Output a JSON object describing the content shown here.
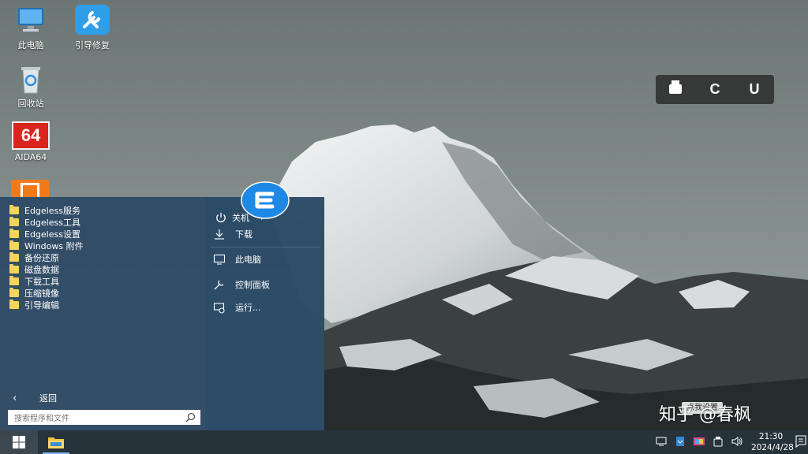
{
  "desktop": {
    "icons": [
      {
        "label": "此电脑"
      },
      {
        "label": "引导修复"
      },
      {
        "label": "回收站"
      },
      {
        "label": "AIDA64",
        "glyph_text": "64"
      }
    ]
  },
  "float_toolbar": {
    "items": [
      "",
      "C",
      "U"
    ]
  },
  "start_menu": {
    "folders": [
      {
        "label": "Edgeless服务"
      },
      {
        "label": "Edgeless工具"
      },
      {
        "label": "Edgeless设置"
      },
      {
        "label": "Windows 附件"
      },
      {
        "label": "备份还原"
      },
      {
        "label": "磁盘数据"
      },
      {
        "label": "下载工具"
      },
      {
        "label": "压缩镜像"
      },
      {
        "label": "引导编辑"
      }
    ],
    "back_label": "返回",
    "search_placeholder": "搜索程序和文件",
    "right_items": [
      {
        "label": "下载",
        "icon": "download-icon"
      },
      {
        "label": "此电脑",
        "icon": "computer-icon"
      },
      {
        "label": "控制面板",
        "icon": "wrench-icon"
      },
      {
        "label": "运行...",
        "icon": "run-icon"
      }
    ],
    "power_label": "关机"
  },
  "taskbar": {
    "time": "21:30",
    "date": "2024/4/28"
  },
  "tooltip": "点我设置",
  "watermark": "知乎 @春枫",
  "colors": {
    "menu_bg": "#2c4864",
    "folder": "#f4d35e",
    "taskbar": "#1e2a34",
    "accent": "#1e88e5"
  }
}
